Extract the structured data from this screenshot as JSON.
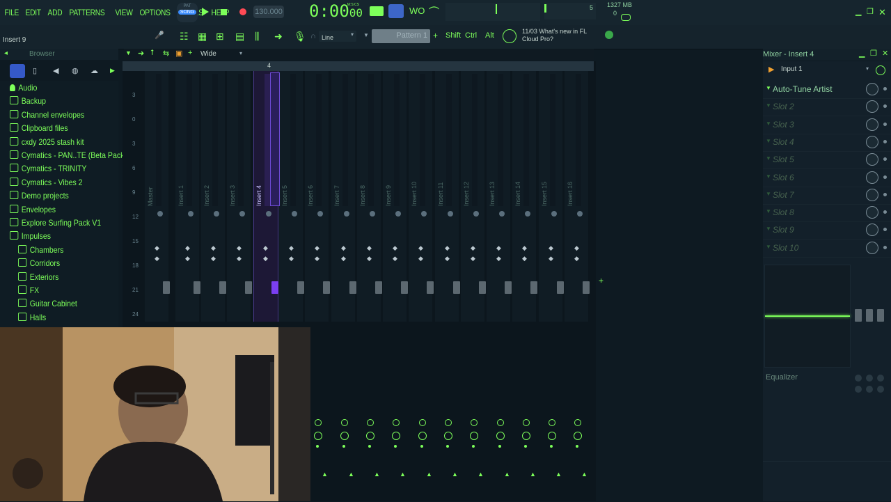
{
  "menu": [
    "FILE",
    "EDIT",
    "ADD",
    "PATTERNS",
    "VIEW",
    "OPTIONS",
    "TOOLS",
    "HELP"
  ],
  "transport": {
    "mode_top": "PAT",
    "mode_bottom": "SONG",
    "tempo": "130.000",
    "time": "0:00",
    "time_small": "00",
    "time_unit": "M:S:CS",
    "cpu_voices": "5",
    "memory": "1327 MB",
    "voices_zero": "0"
  },
  "hint": "Insert 9",
  "toolbar2": {
    "snap": "Line",
    "pattern": "Pattern 1",
    "keys": [
      "Shift",
      "Ctrl",
      "Alt"
    ],
    "news_date": "11/03",
    "news_line1": "What's new in FL",
    "news_line2": "Cloud Pro?"
  },
  "browser": {
    "title": "Browser",
    "items": [
      {
        "label": "Audio",
        "indent": 0
      },
      {
        "label": "Backup",
        "indent": 0
      },
      {
        "label": "Channel envelopes",
        "indent": 0
      },
      {
        "label": "Clipboard files",
        "indent": 0
      },
      {
        "label": "cxdy 2025 stash kit",
        "indent": 0
      },
      {
        "label": "Cymatics - PAN..TE (Beta Pack)",
        "indent": 0
      },
      {
        "label": "Cymatics - TRINITY",
        "indent": 0
      },
      {
        "label": "Cymatics - Vibes 2",
        "indent": 0
      },
      {
        "label": "Demo projects",
        "indent": 0
      },
      {
        "label": "Envelopes",
        "indent": 0
      },
      {
        "label": "Explore Surfing Pack V1",
        "indent": 0
      },
      {
        "label": "Impulses",
        "indent": 0
      },
      {
        "label": "Chambers",
        "indent": 1
      },
      {
        "label": "Corridors",
        "indent": 1
      },
      {
        "label": "Exteriors",
        "indent": 1
      },
      {
        "label": "FX",
        "indent": 1
      },
      {
        "label": "Guitar Cabinet",
        "indent": 1
      },
      {
        "label": "Halls",
        "indent": 1
      }
    ]
  },
  "mixer": {
    "view": "Wide",
    "db_scale": [
      "3",
      "0",
      "3",
      "6",
      "9",
      "12",
      "15",
      "18",
      "21",
      "24"
    ],
    "tracks": [
      "Master",
      "Insert 1",
      "Insert 2",
      "Insert 3",
      "Insert 4",
      "Insert 5",
      "Insert 6",
      "Insert 7",
      "Insert 8",
      "Insert 9",
      "Insert 10",
      "Insert 11",
      "Insert 12",
      "Insert 13",
      "Insert 14",
      "Insert 15",
      "Insert 16"
    ],
    "selected": "Insert 4",
    "header_selected_number": "4"
  },
  "right_panel": {
    "title": "Mixer - Insert 4",
    "input": "Input 1",
    "slots": [
      "Auto-Tune Artist",
      "Slot 2",
      "Slot 3",
      "Slot 4",
      "Slot 5",
      "Slot 6",
      "Slot 7",
      "Slot 8",
      "Slot 9",
      "Slot 10"
    ],
    "equalizer": "Equalizer"
  },
  "colors": {
    "accent": "#7dff5a",
    "background": "#0e1a22",
    "selected": "#7b3ff2"
  }
}
